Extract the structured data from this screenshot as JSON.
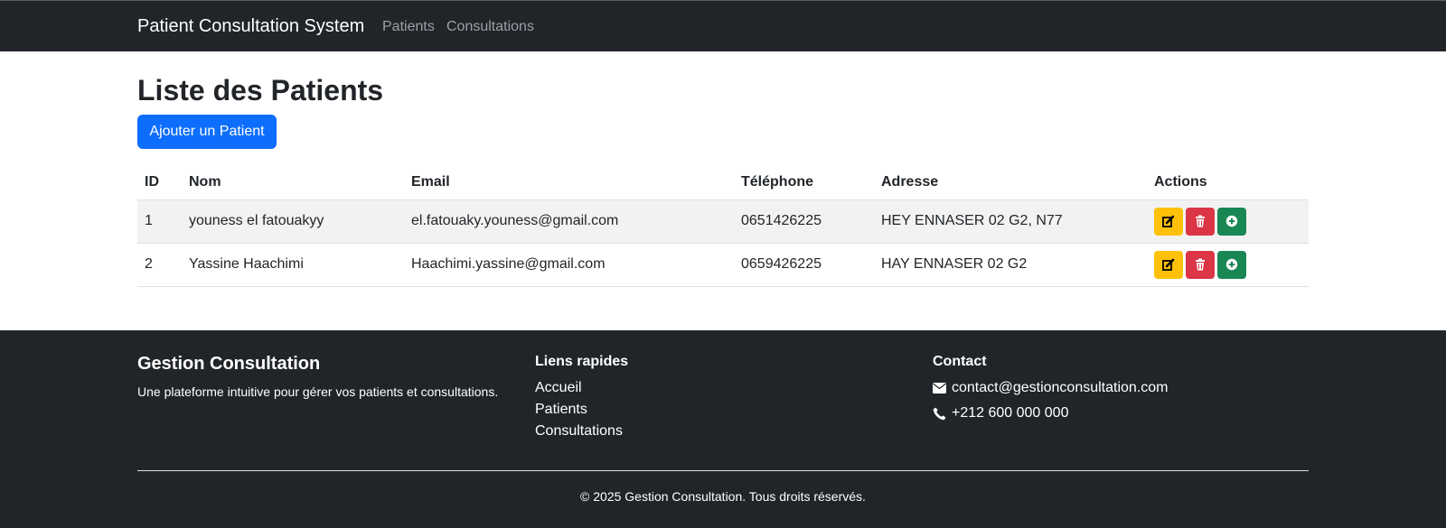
{
  "navbar": {
    "brand": "Patient Consultation System",
    "links": [
      "Patients",
      "Consultations"
    ]
  },
  "main": {
    "title": "Liste des Patients",
    "add_button": "Ajouter un Patient",
    "table": {
      "headers": [
        "ID",
        "Nom",
        "Email",
        "Téléphone",
        "Adresse",
        "Actions"
      ],
      "rows": [
        {
          "id": "1",
          "nom": "youness el fatouakyy",
          "email": "el.fatouaky.youness@gmail.com",
          "telephone": "0651426225",
          "adresse": "HEY ENNASER 02 G2, N77"
        },
        {
          "id": "2",
          "nom": "Yassine Haachimi",
          "email": "Haachimi.yassine@gmail.com",
          "telephone": "0659426225",
          "adresse": "HAY ENNASER 02 G2"
        }
      ],
      "action_icons": [
        "edit-icon",
        "trash-icon",
        "plus-circle-icon"
      ]
    }
  },
  "footer": {
    "title": "Gestion Consultation",
    "description": "Une plateforme intuitive pour gérer vos patients et consultations.",
    "quick_links_title": "Liens rapides",
    "quick_links": [
      "Accueil",
      "Patients",
      "Consultations"
    ],
    "contact_title": "Contact",
    "email": "contact@gestionconsultation.com",
    "phone": "+212 600 000 000",
    "copyright": "© 2025 Gestion Consultation. Tous droits réservés."
  },
  "colors": {
    "navbar": "#212529",
    "primary": "#0d6efd",
    "warning": "#ffc107",
    "danger": "#dc3545",
    "success": "#198754"
  }
}
